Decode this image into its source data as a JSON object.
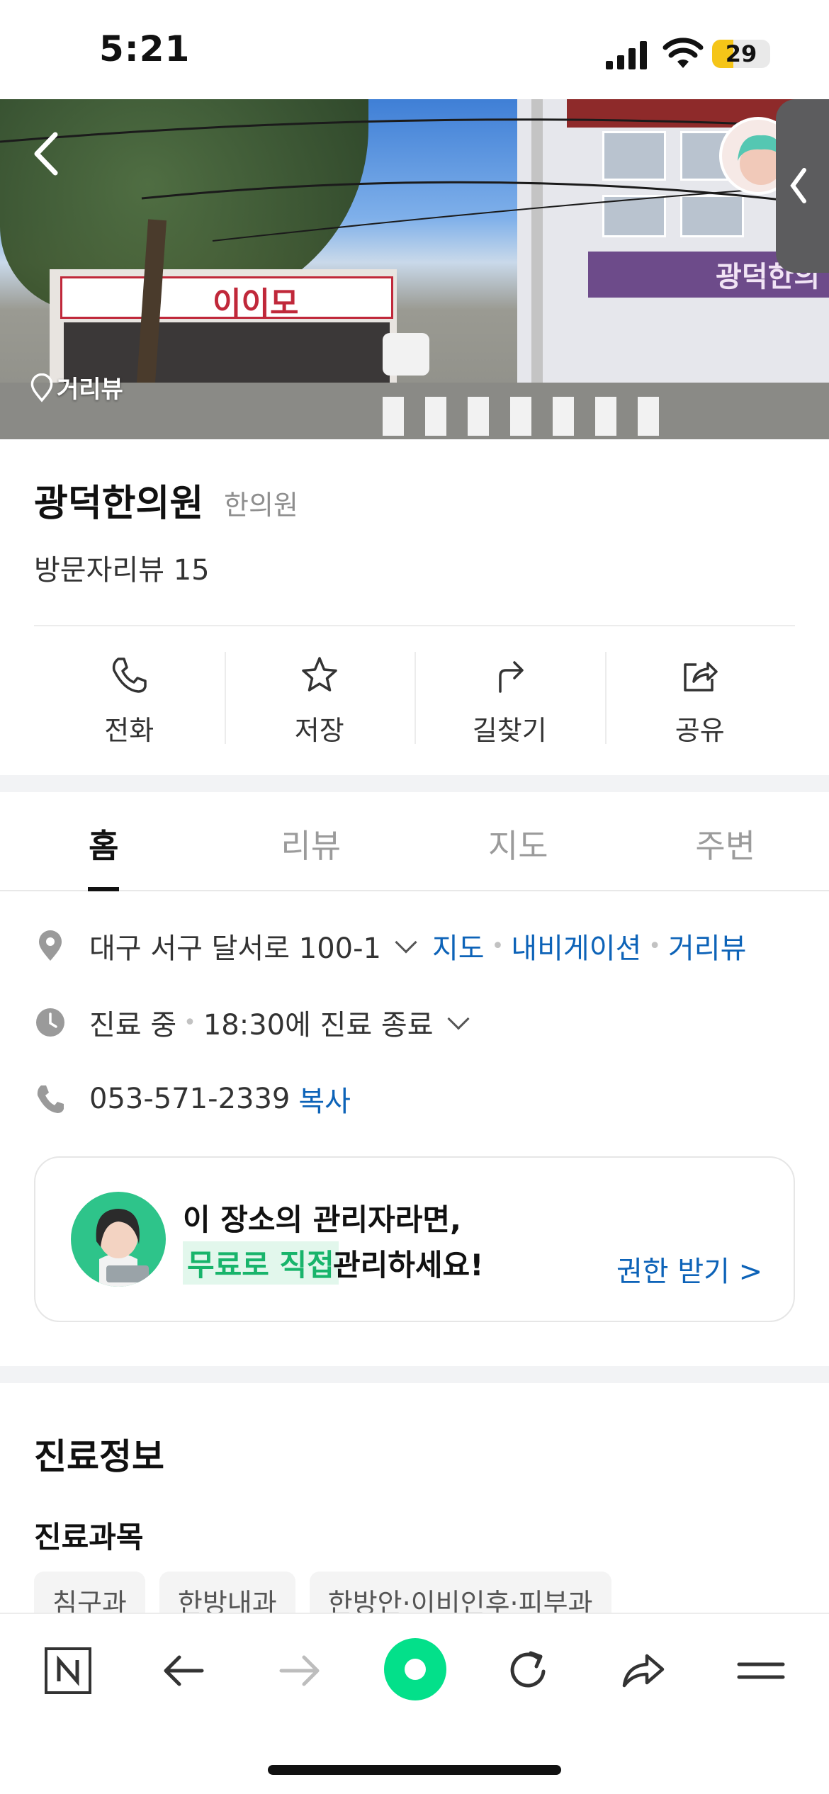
{
  "status_bar": {
    "time": "5:21",
    "battery": "29"
  },
  "hero": {
    "street_view_label": "거리뷰",
    "storefront_sign": "이이모",
    "right_building_sign": "광덕한의"
  },
  "place": {
    "name": "광덕한의원",
    "category": "한의원",
    "visitor_reviews": "방문자리뷰 15"
  },
  "actions": [
    {
      "label": "전화",
      "icon": "phone-icon"
    },
    {
      "label": "저장",
      "icon": "star-icon"
    },
    {
      "label": "길찾기",
      "icon": "directions-icon"
    },
    {
      "label": "공유",
      "icon": "share-icon"
    }
  ],
  "tabs": [
    {
      "label": "홈",
      "active": true
    },
    {
      "label": "리뷰",
      "active": false
    },
    {
      "label": "지도",
      "active": false
    },
    {
      "label": "주변",
      "active": false
    }
  ],
  "info": {
    "address": "대구 서구 달서로 100-1",
    "address_links": [
      "지도",
      "내비게이션",
      "거리뷰"
    ],
    "status": "진료 중",
    "hours": "18:30에 진료 종료",
    "phone": "053-571-2339",
    "copy_label": "복사"
  },
  "owner_card": {
    "line1": "이 장소의 관리자라면,",
    "highlight": "무료로 직접",
    "line2_rest": "관리하세요!",
    "link": "권한 받기 >"
  },
  "section": {
    "title": "진료정보",
    "subtitle": "진료과목",
    "chips": [
      "침구과",
      "한방내과",
      "한방안·이비인후·피부과"
    ]
  },
  "colors": {
    "link": "#0d63b8",
    "accent_green": "#03c75a",
    "highlight_green": "#18b46b"
  }
}
